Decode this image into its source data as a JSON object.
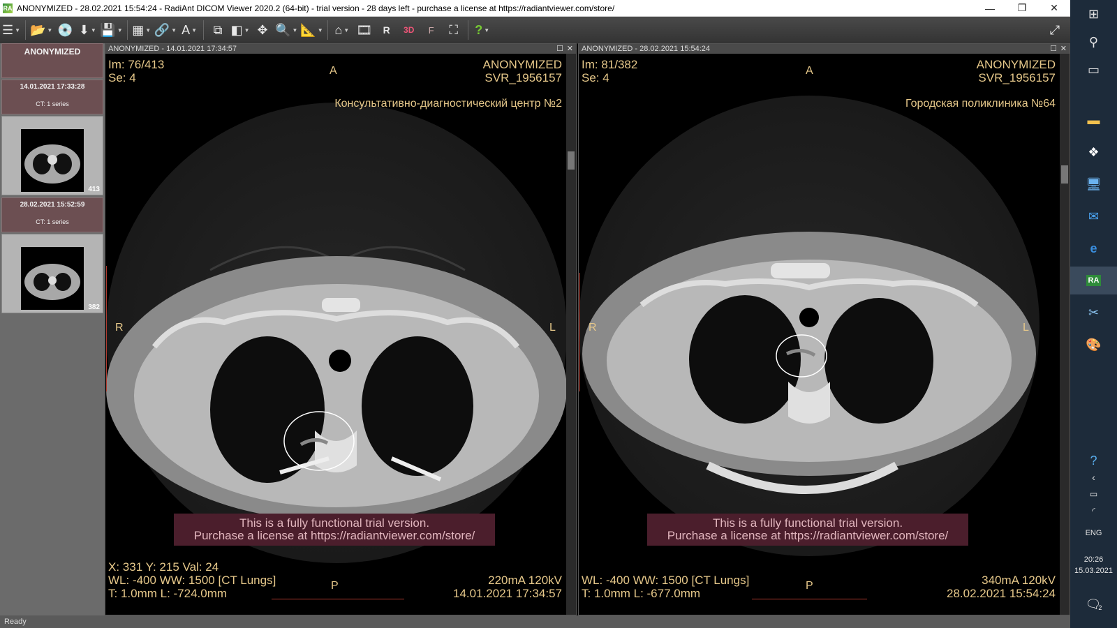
{
  "window": {
    "title": "ANONYMIZED - 28.02.2021 15:54:24 - RadiAnt DICOM Viewer 2020.2 (64-bit) - trial version - 28 days left - purchase a license at https://radiantviewer.com/store/",
    "app_icon_text": "RA",
    "minimize": "—",
    "restore": "❐",
    "close": "✕"
  },
  "toolbar": {
    "menu": "☰",
    "open": "📂",
    "cd": "💿",
    "download": "⬇",
    "save": "💾",
    "layout": "▦",
    "link": "🔗",
    "annotate": "A",
    "series": "⧉",
    "window_level": "◧",
    "pan": "✥",
    "zoom": "🔍",
    "measure": "📐",
    "mpr": "⌂",
    "cine": "🎞",
    "r": "R",
    "3d": "3D",
    "f": "F",
    "fusion": "⛶",
    "help": "?",
    "fullscreen": "⤢"
  },
  "thumbpanel": {
    "patient": "ANONYMIZED",
    "studies": [
      {
        "date": "14.01.2021 17:33:28",
        "series": "CT: 1 series",
        "image_count": "413"
      },
      {
        "date": "28.02.2021 15:52:59",
        "series": "CT: 1 series",
        "image_count": "382"
      }
    ]
  },
  "viewports": [
    {
      "header": "ANONYMIZED  - 14.01.2021 17:34:57",
      "im": "Im: 76/413",
      "se": "Se: 4",
      "patient": "ANONYMIZED",
      "id": "SVR_1956157",
      "institution": "Консультативно-диагностический центр №2",
      "orient_top": "A",
      "orient_bottom": "P",
      "orient_left": "R",
      "orient_right": "L",
      "trial_line1": "This is a fully functional trial version.",
      "trial_line2": "Purchase a license at https://radiantviewer.com/store/",
      "cursor": "X: 331 Y: 215 Val: 24",
      "wl": "WL: -400 WW: 1500 [CT Lungs]",
      "thickness": "T: 1.0mm L: -724.0mm",
      "exposure": "220mA 120kV",
      "datetime": "14.01.2021 17:34:57"
    },
    {
      "header": "ANONYMIZED  - 28.02.2021 15:54:24",
      "im": "Im: 81/382",
      "se": "Se: 4",
      "patient": "ANONYMIZED",
      "id": "SVR_1956157",
      "institution": "Городская поликлиника №64",
      "orient_top": "A",
      "orient_bottom": "P",
      "orient_left": "R",
      "orient_right": "L",
      "trial_line1": "This is a fully functional trial version.",
      "trial_line2": "Purchase a license at https://radiantviewer.com/store/",
      "cursor": "",
      "wl": "WL: -400 WW: 1500 [CT Lungs]",
      "thickness": "T: 1.0mm L: -677.0mm",
      "exposure": "340mA 120kV",
      "datetime": "28.02.2021 15:54:24"
    }
  ],
  "status": "Ready",
  "taskbar": {
    "language": "ENG",
    "time": "20:26",
    "date": "15.03.2021",
    "notification_count": "2"
  }
}
